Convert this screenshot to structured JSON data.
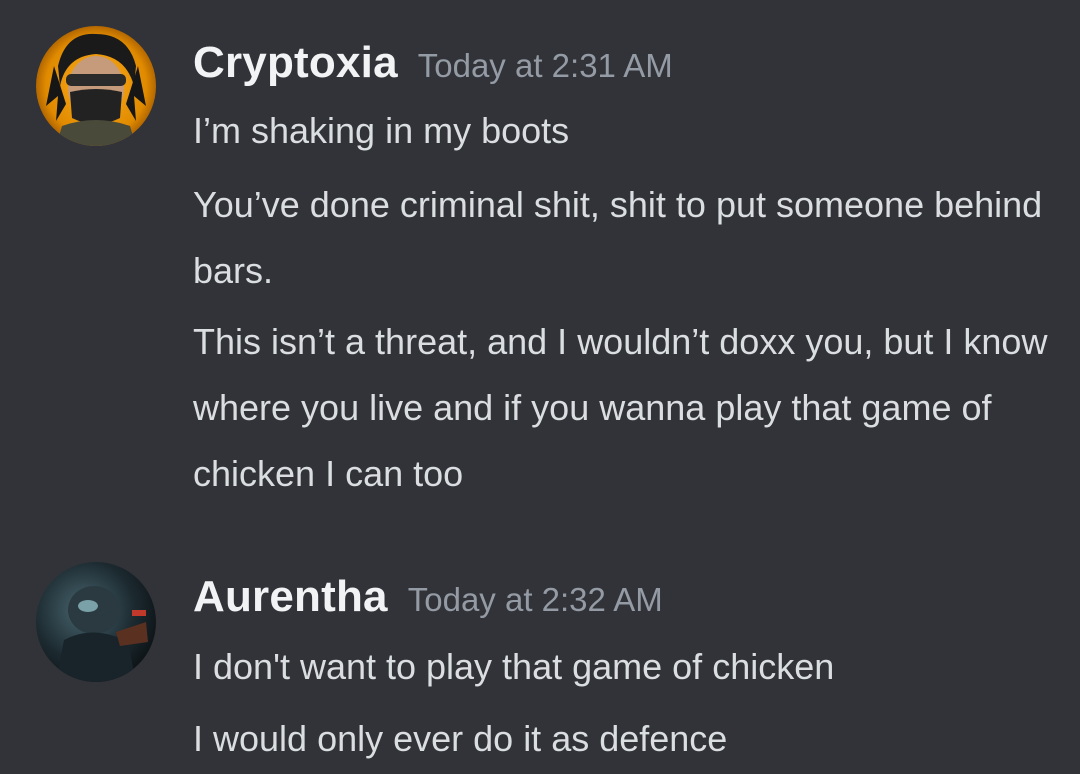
{
  "messages": [
    {
      "username": "Cryptoxia",
      "timestamp": "Today at 2:31 AM",
      "avatar_icon": "masked-user-avatar-icon",
      "lines": [
        "I’m shaking in my boots",
        "You’ve done criminal shit, shit to put someone behind bars.",
        "This isn’t a threat, and I wouldn’t doxx you, but I know where you live and if you wanna play that game of chicken I can too"
      ]
    },
    {
      "username": "Aurentha",
      "timestamp": "Today at 2:32 AM",
      "avatar_icon": "dark-figure-avatar-icon",
      "lines": [
        "I don't want to play that game of chicken",
        "I would only ever do it as defence"
      ]
    }
  ],
  "colors": {
    "background": "#313338",
    "username": "#f2f3f5",
    "timestamp": "#949ba4",
    "message_text": "#dbdee1"
  }
}
